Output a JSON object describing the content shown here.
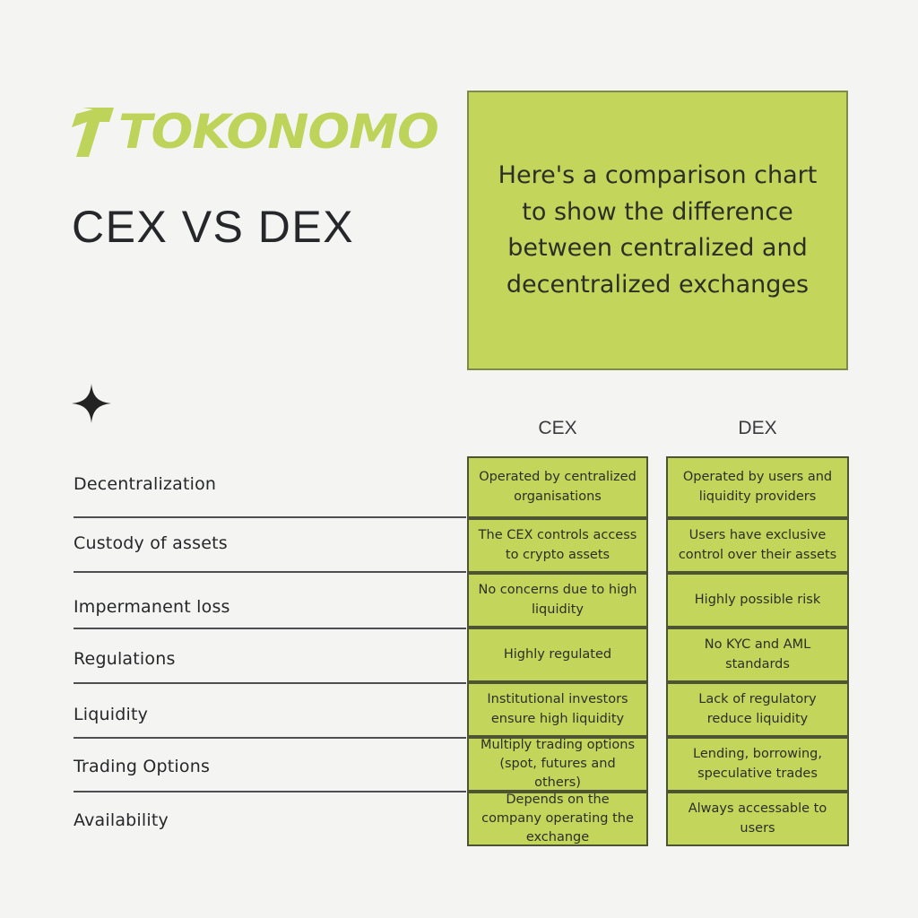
{
  "brand": {
    "logo_text": "TOKONOMO",
    "logo_mark": "stylized-t-arrow",
    "green": "#c3d65b",
    "background": "#f4f4f2",
    "ink": "#26272a"
  },
  "page_title": "CEX VS DEX",
  "banner": {
    "text": "Here's a comparison chart to show the difference between centralized and decentralized exchanges"
  },
  "decoration": {
    "sparkle_icon": "four-point-sparkle-icon"
  },
  "table": {
    "columns": [
      "CEX",
      "DEX"
    ],
    "rows": [
      {
        "label": "Decentralization",
        "cex": "Operated by centralized organisations",
        "dex": "Operated by users and liquidity providers"
      },
      {
        "label": "Custody of assets",
        "cex": "The CEX controls access to crypto assets",
        "dex": "Users have exclusive control over their assets"
      },
      {
        "label": "Impermanent loss",
        "cex": "No concerns due to high liquidity",
        "dex": "Highly possible risk"
      },
      {
        "label": "Regulations",
        "cex": "Highly regulated",
        "dex": "No KYC and AML standards"
      },
      {
        "label": "Liquidity",
        "cex": "Institutional investors ensure high liquidity",
        "dex": "Lack of regulatory reduce liquidity"
      },
      {
        "label": "Trading Options",
        "cex": "Multiply trading options (spot, futures and others)",
        "dex": "Lending, borrowing, speculative trades"
      },
      {
        "label": "Availability",
        "cex": "Depends on the company operating the exchange",
        "dex": "Always accessable to users"
      }
    ]
  }
}
